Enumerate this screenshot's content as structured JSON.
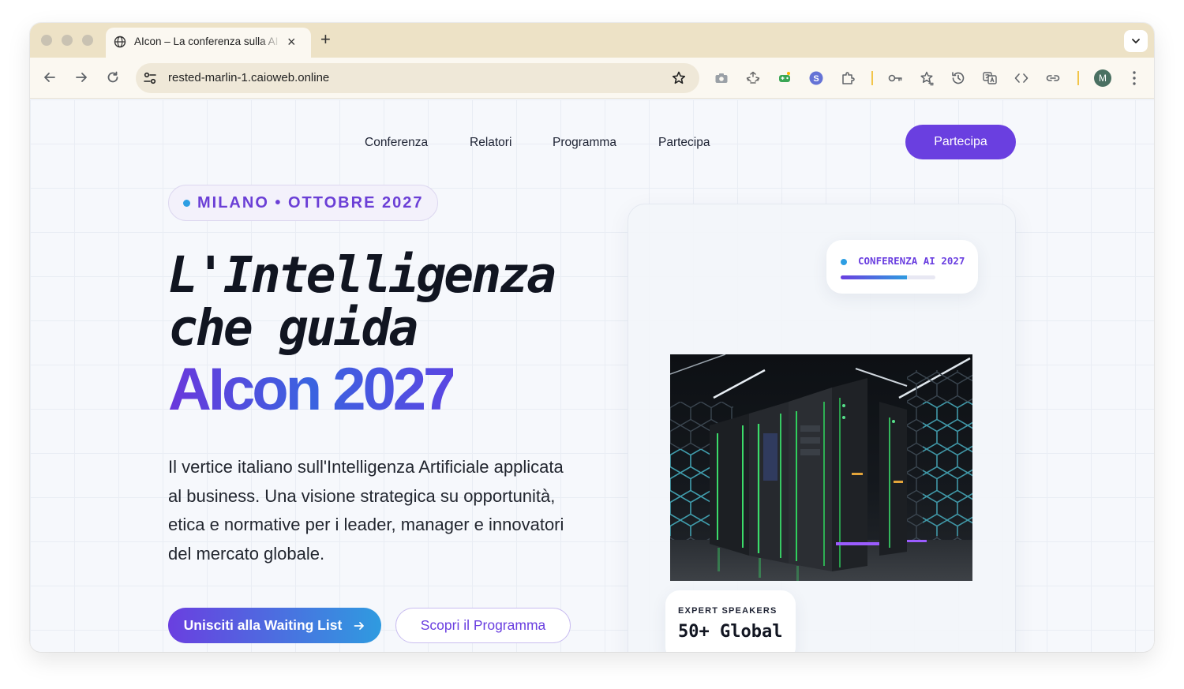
{
  "browser": {
    "tab_title": "AIcon – La conferenza sulla AI",
    "tab_close": "×",
    "new_tab": "+",
    "url": "rested-marlin-1.caioweb.online",
    "profile_initial": "M",
    "extension_badge": "S"
  },
  "nav": {
    "links": [
      "Conferenza",
      "Relatori",
      "Programma",
      "Partecipa"
    ],
    "cta": "Partecipa"
  },
  "hero": {
    "eyebrow": "MILANO • OTTOBRE 2027",
    "title_line1": "L'Intelligenza",
    "title_line2": "che guida",
    "title_gradient": "AIcon 2027",
    "lead": "Il vertice italiano sull'Intelligenza Artificiale applicata al business. Una visione strategica su opportunità, etica e normative per i leader, manager e innovatori del mercato globale.",
    "primary_button": "Unisciti alla Waiting List",
    "primary_button_icon": "arrow-right-icon",
    "secondary_button": "Scopri il Programma"
  },
  "card": {
    "chip_label": "CONFERENZA AI 2027",
    "chip_progress": 0.7,
    "image_description_name": "server-racks-image",
    "stat_label": "EXPERT SPEAKERS",
    "stat_value": "50+ Global"
  },
  "colors": {
    "accent": "#6a3fe0",
    "accent_blue": "#2f9be0",
    "tabstrip": "#ede2c6",
    "toolbar": "#fbf8f1"
  }
}
